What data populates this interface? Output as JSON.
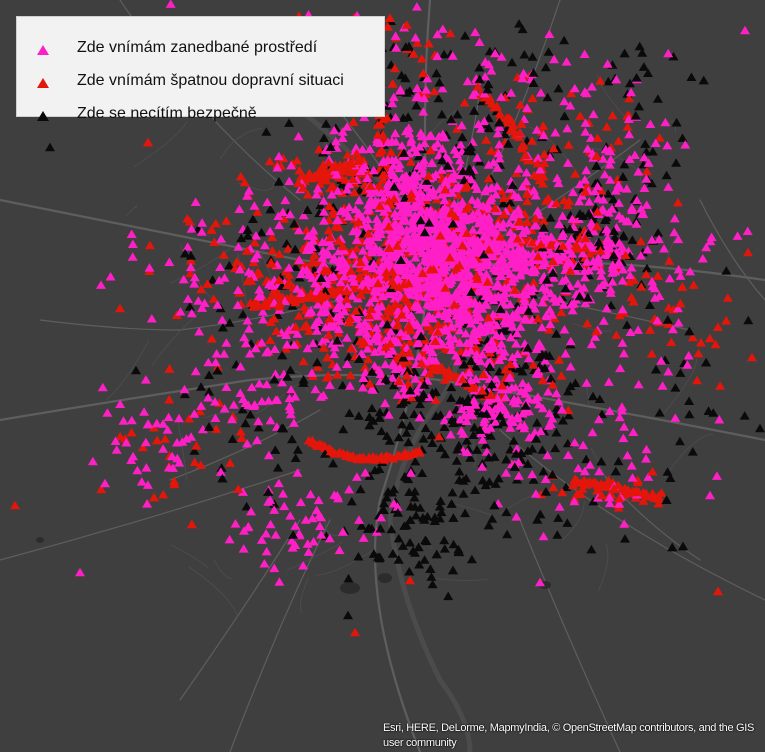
{
  "legend": {
    "items": [
      {
        "label": "Zde vnímám zanedbané prostředí",
        "color": "#ff1fc6",
        "icon": "triangle-icon"
      },
      {
        "label": "Zde vnímám špatnou dopravní situaci",
        "color": "#e4160b",
        "icon": "triangle-icon"
      },
      {
        "label": "Zde se necítím bezpečně",
        "color": "#0a0a0a",
        "icon": "triangle-icon"
      }
    ]
  },
  "attribution": "Esri, HERE, DeLorme, MapmyIndia, © OpenStreetMap contributors, and the GIS user community",
  "colors": {
    "basemap": "#3f3f3f",
    "roads": "#5e5e5e",
    "river": "#4b4b4b",
    "neglected": "#ff1fc6",
    "traffic": "#e4160b",
    "unsafe": "#0a0a0a"
  }
}
